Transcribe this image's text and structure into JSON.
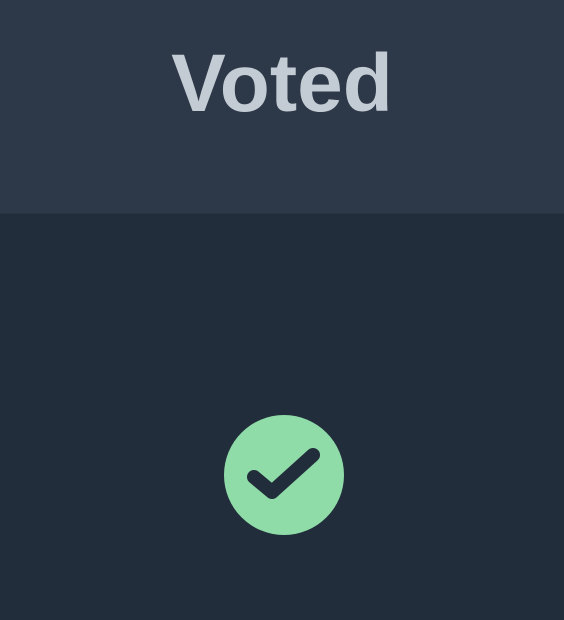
{
  "header": {
    "title": "Voted"
  },
  "status": {
    "icon": "checkmark-icon",
    "state": "voted"
  },
  "colors": {
    "header_bg": "#2d3848",
    "body_bg": "#222d3b",
    "title_text": "#c3ccd4",
    "success": "#8fdca9",
    "check_stroke": "#222d3b"
  }
}
